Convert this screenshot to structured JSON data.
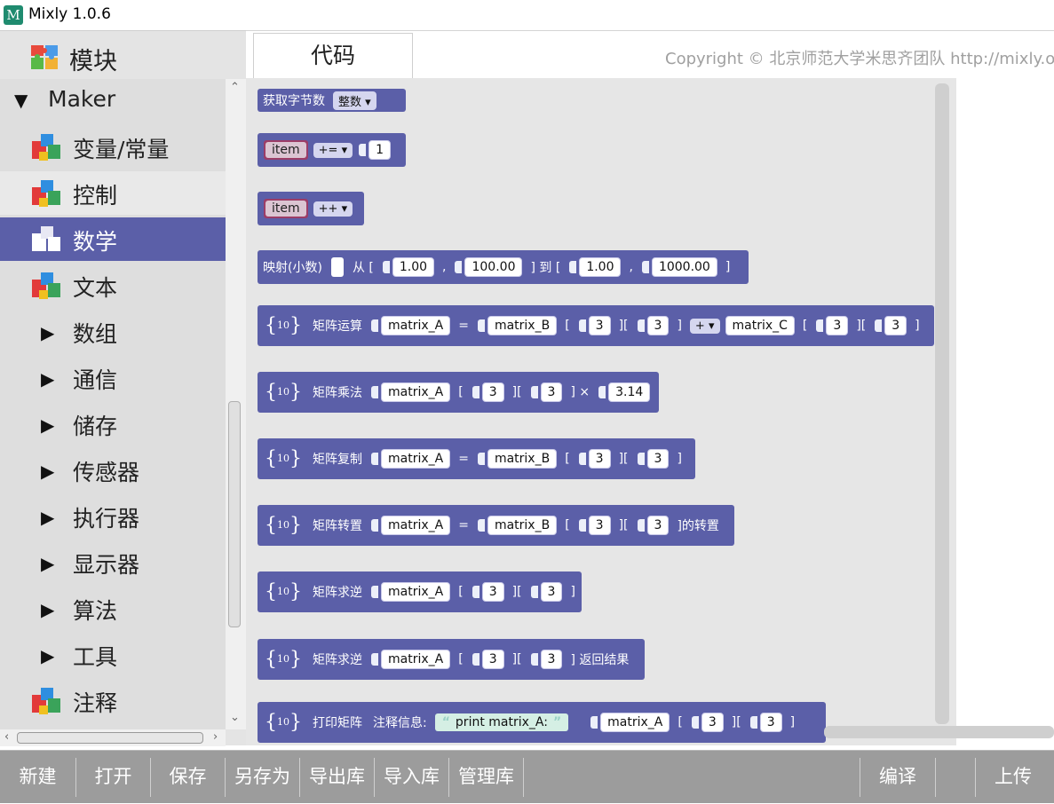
{
  "window": {
    "title": "Mixly 1.0.6",
    "icon": "mixly-logo-icon"
  },
  "sidebar": {
    "module_label": "模块",
    "root_label": "Maker",
    "items": [
      {
        "label": "变量/常量",
        "icon": "blocks-icon",
        "state": "normal"
      },
      {
        "label": "控制",
        "icon": "blocks-icon",
        "state": "hover"
      },
      {
        "label": "数学",
        "icon": "blocks-icon",
        "state": "active"
      },
      {
        "label": "文本",
        "icon": "blocks-icon",
        "state": "normal"
      },
      {
        "label": "数组",
        "icon": "expand-arrow-icon",
        "state": "normal"
      },
      {
        "label": "通信",
        "icon": "expand-arrow-icon",
        "state": "normal"
      },
      {
        "label": "储存",
        "icon": "expand-arrow-icon",
        "state": "normal"
      },
      {
        "label": "传感器",
        "icon": "expand-arrow-icon",
        "state": "normal"
      },
      {
        "label": "执行器",
        "icon": "expand-arrow-icon",
        "state": "normal"
      },
      {
        "label": "显示器",
        "icon": "expand-arrow-icon",
        "state": "normal"
      },
      {
        "label": "算法",
        "icon": "expand-arrow-icon",
        "state": "normal"
      },
      {
        "label": "工具",
        "icon": "expand-arrow-icon",
        "state": "normal"
      },
      {
        "label": "注释",
        "icon": "blocks-icon",
        "state": "normal"
      }
    ]
  },
  "tabs": {
    "code": "代码"
  },
  "copyright": "Copyright © 北京师范大学米思齐团队 http://mixly.org/",
  "colors": {
    "block": "#5b5fa8",
    "variable": "#9c3d67",
    "toolbar": "#9c9c9c",
    "active_category": "#5b5fa8"
  },
  "blocks": {
    "b1": {
      "label": "获取字节数",
      "type": "整数"
    },
    "b2": {
      "var": "item",
      "op": "+=",
      "value": "1"
    },
    "b3": {
      "var": "item",
      "op": "++"
    },
    "b4": {
      "label": "映射(小数)",
      "from": "从 [",
      "v1": "1.00",
      "comma1": ",",
      "v2": "100.00",
      "to": "] 到 [",
      "v3": "1.00",
      "comma2": ",",
      "v4": "1000.00",
      "close": "]"
    },
    "b5": {
      "label": "矩阵运算",
      "a": "matrix_A",
      "eq": "=",
      "b": "matrix_B",
      "ob": "[",
      "r1": "3",
      "mid": "][",
      "c1": "3",
      "cb": "]",
      "op": "+",
      "c": "matrix_C",
      "ob2": "[",
      "r2": "3",
      "mid2": "][",
      "c2": "3",
      "cb2": "]"
    },
    "b6": {
      "label": "矩阵乘法",
      "a": "matrix_A",
      "ob": "[",
      "r": "3",
      "mid": "][",
      "c": "3",
      "times": "] ×",
      "k": "3.14"
    },
    "b7": {
      "label": "矩阵复制",
      "a": "matrix_A",
      "eq": "=",
      "b": "matrix_B",
      "ob": "[",
      "r": "3",
      "mid": "][",
      "c": "3",
      "cb": "]"
    },
    "b8": {
      "label": "矩阵转置",
      "a": "matrix_A",
      "eq": "=",
      "b": "matrix_B",
      "ob": "[",
      "r": "3",
      "mid": "][",
      "c": "3",
      "tail": "]的转置"
    },
    "b9": {
      "label": "矩阵求逆",
      "a": "matrix_A",
      "ob": "[",
      "r": "3",
      "mid": "][",
      "c": "3",
      "cb": "]"
    },
    "b10": {
      "label": "矩阵求逆",
      "a": "matrix_A",
      "ob": "[",
      "r": "3",
      "mid": "][",
      "c": "3",
      "tail": "] 返回结果"
    },
    "b11": {
      "label": "打印矩阵",
      "note": "注释信息:",
      "msg": "print matrix_A:",
      "a": "matrix_A",
      "ob": "[",
      "r": "3",
      "mid": "][",
      "c": "3",
      "cb": "]"
    },
    "matrix_icon": {
      "top": "10",
      "bottom": "01"
    }
  },
  "toolbar": {
    "new": "新建",
    "open": "打开",
    "save": "保存",
    "save_as": "另存为",
    "export_lib": "导出库",
    "import_lib": "导入库",
    "manage_lib": "管理库",
    "compile": "编译",
    "upload": "上传"
  }
}
